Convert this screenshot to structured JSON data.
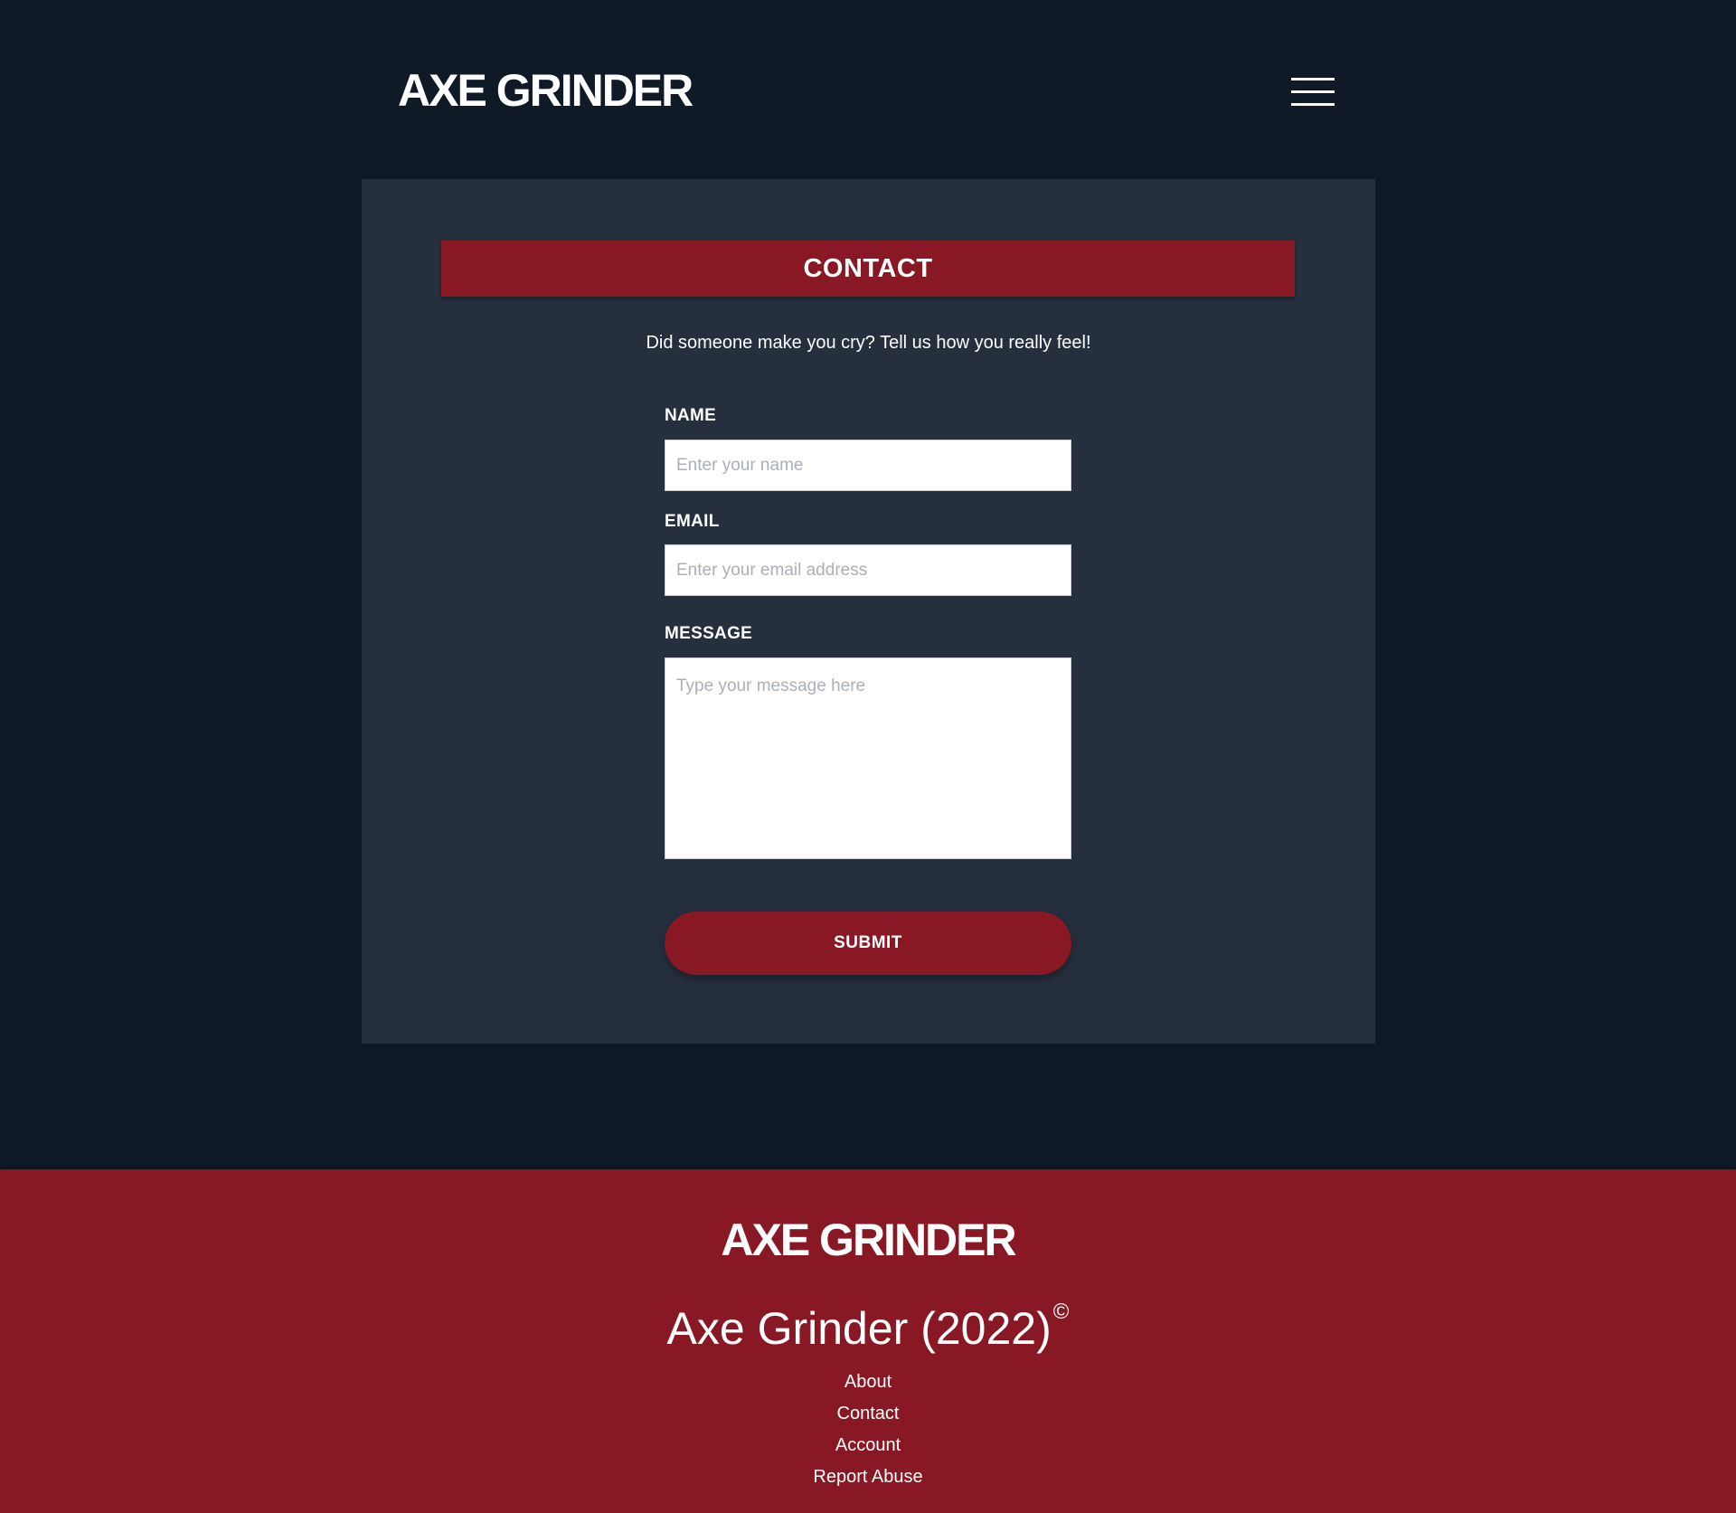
{
  "header": {
    "logo": "AXE GRINDER",
    "menu_icon": "hamburger-menu-icon"
  },
  "contact": {
    "title": "CONTACT",
    "tagline": "Did someone make you cry? Tell us how you really feel!",
    "form": {
      "name_label": "NAME",
      "name_placeholder": "Enter your name",
      "name_value": "",
      "email_label": "EMAIL",
      "email_placeholder": "Enter your email address",
      "email_value": "",
      "message_label": "MESSAGE",
      "message_placeholder": "Type your message here",
      "message_value": "",
      "submit_label": "SUBMIT"
    }
  },
  "footer": {
    "logo": "AXE GRINDER",
    "copyright_text": "Axe Grinder (2022)",
    "copyright_mark": "©",
    "links": [
      {
        "label": "About"
      },
      {
        "label": "Contact"
      },
      {
        "label": "Account"
      },
      {
        "label": "Report Abuse"
      }
    ]
  },
  "colors": {
    "page_background": "#101926",
    "card_background": "#252f3d",
    "accent": "#881823",
    "text": "#ffffff"
  }
}
